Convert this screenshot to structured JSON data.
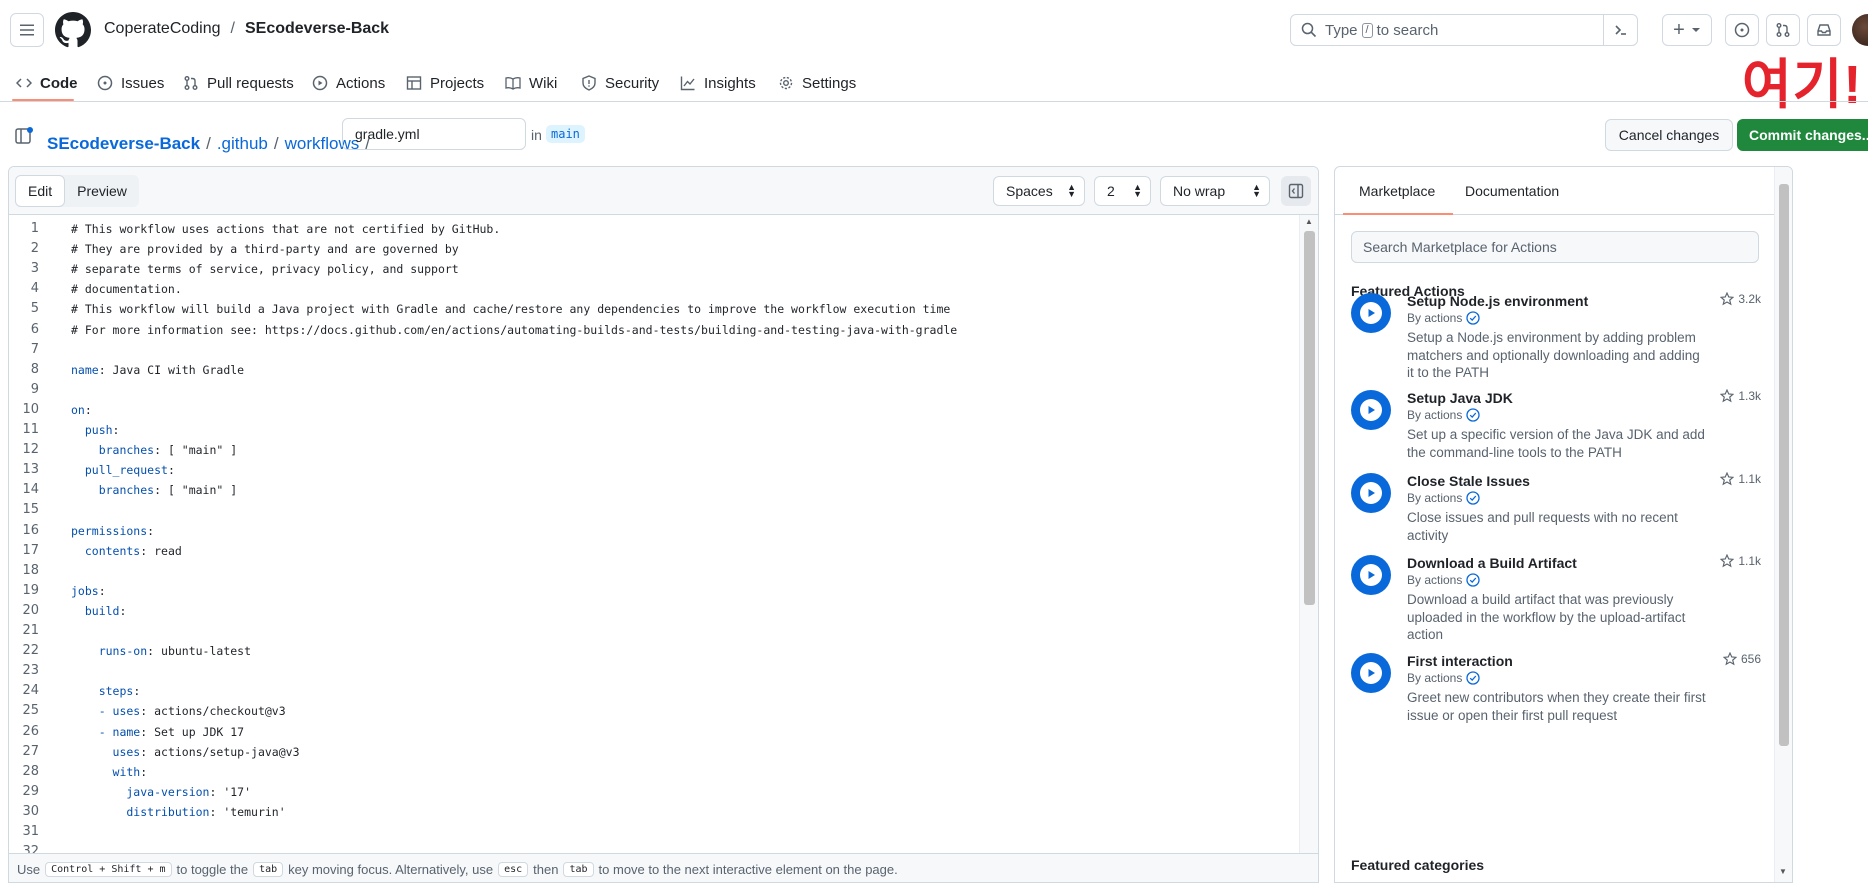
{
  "header": {
    "owner": "CoperateCoding",
    "separator": "/",
    "repo": "SEcodeverse-Back",
    "search_prefix": "Type",
    "search_key": "/",
    "search_suffix": "to search",
    "plus_label": "+"
  },
  "overlay_text": "여기!",
  "nav": {
    "items": [
      {
        "label": "Code"
      },
      {
        "label": "Issues"
      },
      {
        "label": "Pull requests"
      },
      {
        "label": "Actions"
      },
      {
        "label": "Projects"
      },
      {
        "label": "Wiki"
      },
      {
        "label": "Security"
      },
      {
        "label": "Insights"
      },
      {
        "label": "Settings"
      }
    ]
  },
  "editbar": {
    "crumbs": [
      "SEcodeverse-Back",
      ".github",
      "workflows"
    ],
    "sep": "/",
    "filename": "gradle.yml",
    "in_label": "in",
    "branch": "main",
    "cancel_label": "Cancel changes",
    "commit_label": "Commit changes..."
  },
  "editor": {
    "tab_edit": "Edit",
    "tab_preview": "Preview",
    "indent_mode": "Spaces",
    "indent_size": "2",
    "wrap_mode": "No wrap",
    "lines": [
      {
        "n": "1",
        "key": "",
        "text": "# This workflow uses actions that are not certified by GitHub."
      },
      {
        "n": "2",
        "key": "",
        "text": "# They are provided by a third-party and are governed by"
      },
      {
        "n": "3",
        "key": "",
        "text": "# separate terms of service, privacy policy, and support"
      },
      {
        "n": "4",
        "key": "",
        "text": "# documentation."
      },
      {
        "n": "5",
        "key": "",
        "text": "# This workflow will build a Java project with Gradle and cache/restore any dependencies to improve the workflow execution time"
      },
      {
        "n": "6",
        "key": "",
        "text": "# For more information see: https://docs.github.com/en/actions/automating-builds-and-tests/building-and-testing-java-with-gradle"
      },
      {
        "n": "7",
        "key": "",
        "text": ""
      },
      {
        "n": "8",
        "key": "name",
        "text": ": Java CI with Gradle"
      },
      {
        "n": "9",
        "key": "",
        "text": ""
      },
      {
        "n": "10",
        "key": "on",
        "text": ":"
      },
      {
        "n": "11",
        "key": "  push",
        "text": ":"
      },
      {
        "n": "12",
        "key": "    branches",
        "text": ": [ \"main\" ]"
      },
      {
        "n": "13",
        "key": "  pull_request",
        "text": ":"
      },
      {
        "n": "14",
        "key": "    branches",
        "text": ": [ \"main\" ]"
      },
      {
        "n": "15",
        "key": "",
        "text": ""
      },
      {
        "n": "16",
        "key": "permissions",
        "text": ":"
      },
      {
        "n": "17",
        "key": "  contents",
        "text": ": read"
      },
      {
        "n": "18",
        "key": "",
        "text": ""
      },
      {
        "n": "19",
        "key": "jobs",
        "text": ":"
      },
      {
        "n": "20",
        "key": "  build",
        "text": ":"
      },
      {
        "n": "21",
        "key": "",
        "text": ""
      },
      {
        "n": "22",
        "key": "    runs-on",
        "text": ": ubuntu-latest"
      },
      {
        "n": "23",
        "key": "",
        "text": ""
      },
      {
        "n": "24",
        "key": "    steps",
        "text": ":"
      },
      {
        "n": "25",
        "key": "    - uses",
        "text": ": actions/checkout@v3"
      },
      {
        "n": "26",
        "key": "    - name",
        "text": ": Set up JDK 17"
      },
      {
        "n": "27",
        "key": "      uses",
        "text": ": actions/setup-java@v3"
      },
      {
        "n": "28",
        "key": "      with",
        "text": ":"
      },
      {
        "n": "29",
        "key": "        java-version",
        "text": ": '17'"
      },
      {
        "n": "30",
        "key": "        distribution",
        "text": ": 'temurin'"
      },
      {
        "n": "31",
        "key": "",
        "text": ""
      },
      {
        "n": "32",
        "key": "",
        "text": ""
      }
    ],
    "footer": {
      "use": "Use",
      "shortcut": "Control + Shift + m",
      "t1": "to toggle the",
      "tab": "tab",
      "t2": "key moving focus. Alternatively, use",
      "esc": "esc",
      "then": "then",
      "tab2": "tab",
      "t3": "to move to the next interactive element on the page."
    }
  },
  "marketplace": {
    "tab_marketplace": "Marketplace",
    "tab_docs": "Documentation",
    "search_placeholder": "Search Marketplace for Actions",
    "featured_heading": "Featured Actions",
    "categories_heading": "Featured categories",
    "actions": [
      {
        "title": "Setup Node.js environment",
        "by": "By actions",
        "desc": "Setup a Node.js environment by adding problem matchers and optionally downloading and adding it to the PATH",
        "stars": "3.2k"
      },
      {
        "title": "Setup Java JDK",
        "by": "By actions",
        "desc": "Set up a specific version of the Java JDK and add the command-line tools to the PATH",
        "stars": "1.3k"
      },
      {
        "title": "Close Stale Issues",
        "by": "By actions",
        "desc": "Close issues and pull requests with no recent activity",
        "stars": "1.1k"
      },
      {
        "title": "Download a Build Artifact",
        "by": "By actions",
        "desc": "Download a build artifact that was previously uploaded in the workflow by the upload-artifact action",
        "stars": "1.1k"
      },
      {
        "title": "First interaction",
        "by": "By actions",
        "desc": "Greet new contributors when they create their first issue or open their first pull request",
        "stars": "656"
      }
    ]
  }
}
